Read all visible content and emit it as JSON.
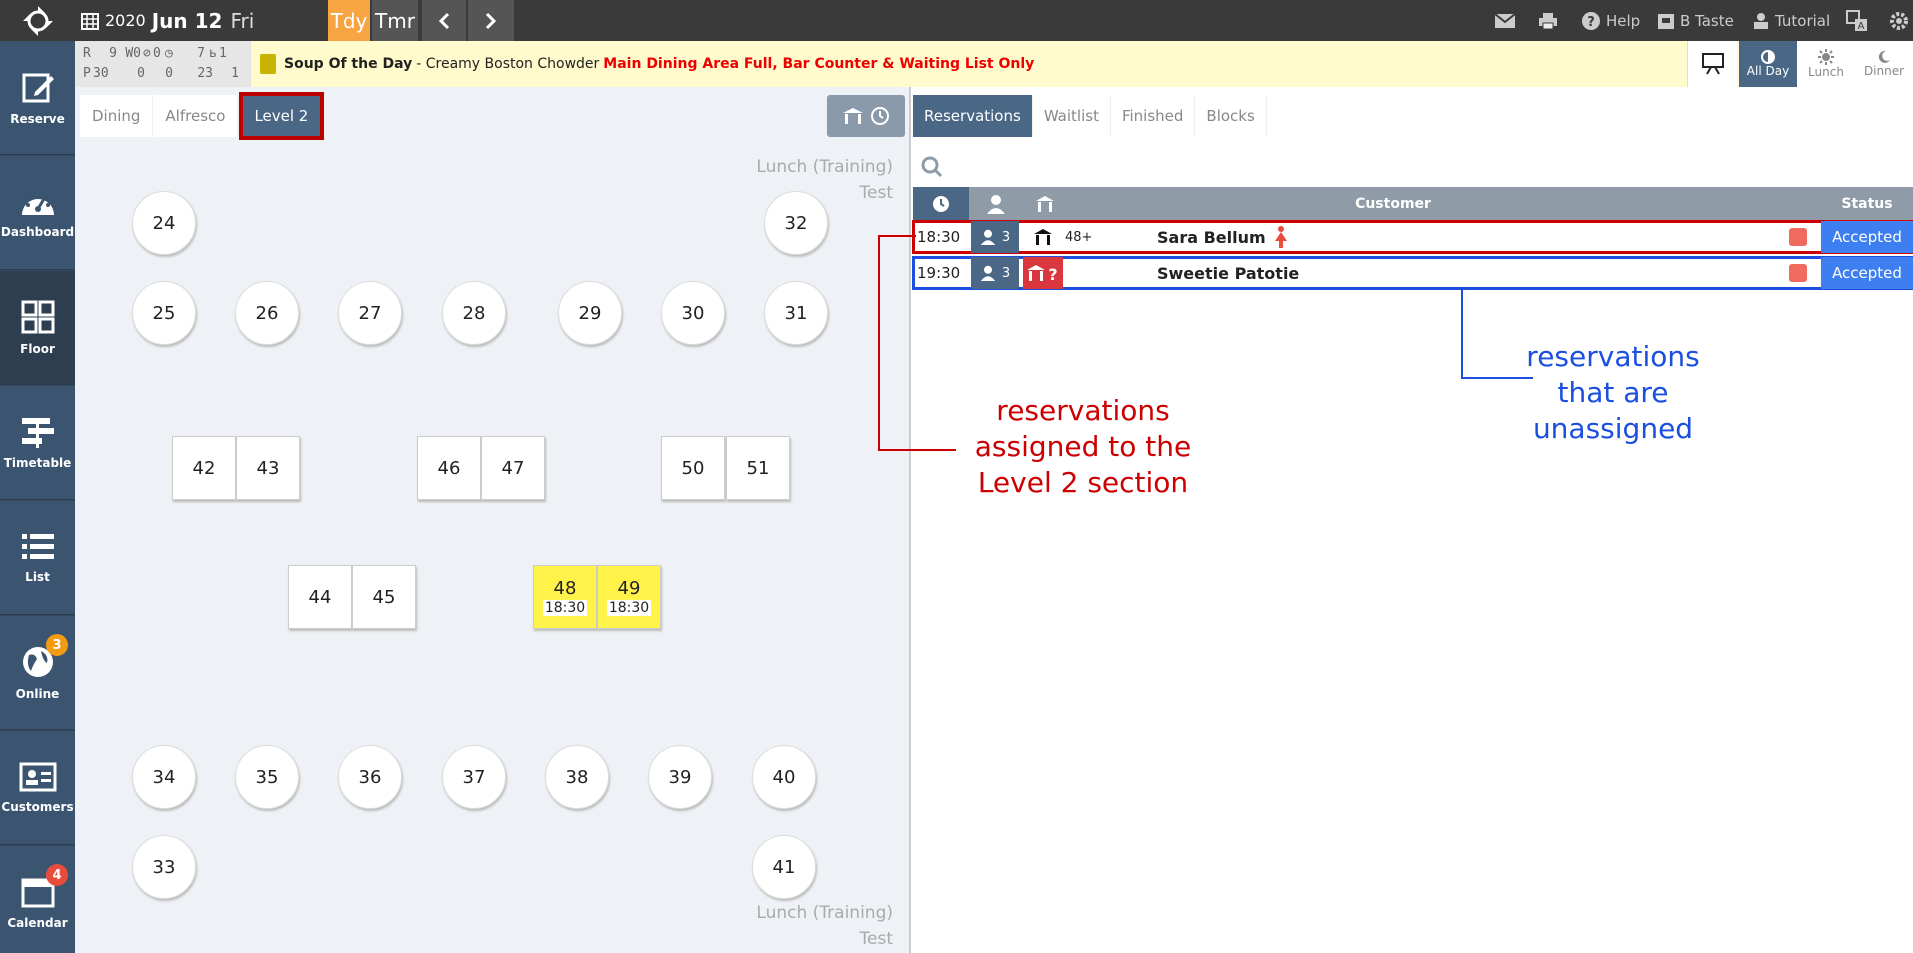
{
  "topbar": {
    "year": "2020",
    "month_day": "Jun 12",
    "weekday": "Fri",
    "today_label": "Tdy",
    "tomorrow_label": "Tmr",
    "links": [
      {
        "label": "",
        "icon": "mail-icon"
      },
      {
        "label": "",
        "icon": "print-icon"
      },
      {
        "label": "Help",
        "icon": "help-icon"
      },
      {
        "label": "B Taste",
        "icon": "store-icon"
      },
      {
        "label": "Tutorial",
        "icon": "tutorial-icon"
      },
      {
        "label": "",
        "icon": "translate-icon"
      },
      {
        "label": "",
        "icon": "gear-icon"
      }
    ]
  },
  "nav": [
    {
      "label": "Reserve",
      "icon": "edit-icon"
    },
    {
      "label": "Dashboard",
      "icon": "gauge-icon"
    },
    {
      "label": "Floor",
      "icon": "grid-icon",
      "active": true
    },
    {
      "label": "Timetable",
      "icon": "timetable-icon"
    },
    {
      "label": "List",
      "icon": "list-icon"
    },
    {
      "label": "Online",
      "icon": "globe-icon",
      "badge": "3"
    },
    {
      "label": "Customers",
      "icon": "id-card-icon"
    },
    {
      "label": "Calendar",
      "icon": "calendar-icon",
      "badge": "4"
    }
  ],
  "counts": {
    "row1": [
      "R",
      "9",
      "W0",
      "0",
      "0",
      "7",
      "1"
    ],
    "row2": [
      "P",
      "30",
      "0",
      "0",
      "23",
      "1"
    ]
  },
  "notice": {
    "title": "Soup Of the Day",
    "text": " - Creamy Boston Chowder",
    "alert": "Main Dining Area Full, Bar Counter & Waiting List Only"
  },
  "shifts": [
    {
      "label": "All Day",
      "icon": "half-moon-icon",
      "active": true
    },
    {
      "label": "Lunch",
      "icon": "sun-icon"
    },
    {
      "label": "Dinner",
      "icon": "moon-icon"
    }
  ],
  "floor": {
    "sections": [
      "Dining",
      "Alfresco",
      "Level 2"
    ],
    "active_section": "Level 2",
    "label_top": "Lunch (Training)",
    "label_top2": "Test",
    "label_bottom": "Lunch (Training)",
    "label_bottom2": "Test",
    "tables": [
      {
        "num": "24",
        "shape": "round"
      },
      {
        "num": "32",
        "shape": "round"
      },
      {
        "num": "25",
        "shape": "round"
      },
      {
        "num": "26",
        "shape": "round"
      },
      {
        "num": "27",
        "shape": "round"
      },
      {
        "num": "28",
        "shape": "round"
      },
      {
        "num": "29",
        "shape": "round"
      },
      {
        "num": "30",
        "shape": "round"
      },
      {
        "num": "31",
        "shape": "round"
      },
      {
        "num": "42",
        "shape": "square"
      },
      {
        "num": "43",
        "shape": "square"
      },
      {
        "num": "46",
        "shape": "square"
      },
      {
        "num": "47",
        "shape": "square"
      },
      {
        "num": "50",
        "shape": "square"
      },
      {
        "num": "51",
        "shape": "square"
      },
      {
        "num": "44",
        "shape": "square"
      },
      {
        "num": "45",
        "shape": "square"
      },
      {
        "num": "48",
        "shape": "square",
        "time": "18:30"
      },
      {
        "num": "49",
        "shape": "square",
        "time": "18:30"
      },
      {
        "num": "34",
        "shape": "round"
      },
      {
        "num": "35",
        "shape": "round"
      },
      {
        "num": "36",
        "shape": "round"
      },
      {
        "num": "37",
        "shape": "round"
      },
      {
        "num": "38",
        "shape": "round"
      },
      {
        "num": "39",
        "shape": "round"
      },
      {
        "num": "40",
        "shape": "round"
      },
      {
        "num": "33",
        "shape": "round"
      },
      {
        "num": "41",
        "shape": "round"
      }
    ]
  },
  "reservations": {
    "tabs": [
      "Reservations",
      "Waitlist",
      "Finished",
      "Blocks"
    ],
    "search_placeholder": "",
    "columns": {
      "customer": "Customer",
      "status": "Status"
    },
    "rows": [
      {
        "time": "18:30",
        "pax": "3",
        "table": "48+",
        "name": "Sara Bellum",
        "status": "Accepted",
        "assigned": true
      },
      {
        "time": "19:30",
        "pax": "3",
        "table": "",
        "name": "Sweetie Patotie",
        "status": "Accepted",
        "assigned": false
      }
    ]
  },
  "annotations": {
    "assigned": "reservations assigned to the Level 2 section",
    "unassigned": "reservations that are unassigned",
    "assigned_lines": [
      "reservations",
      "assigned to the",
      "Level 2 section"
    ],
    "unassigned_lines": [
      "reservations",
      "that are",
      "unassigned"
    ]
  },
  "colors": {
    "accent": "#4a6785",
    "today": "#f7a443",
    "booked": "#fff34a",
    "status_accepted": "#3d7ff0",
    "annot_red": "#cc0000",
    "annot_blue": "#1a4fe0"
  }
}
